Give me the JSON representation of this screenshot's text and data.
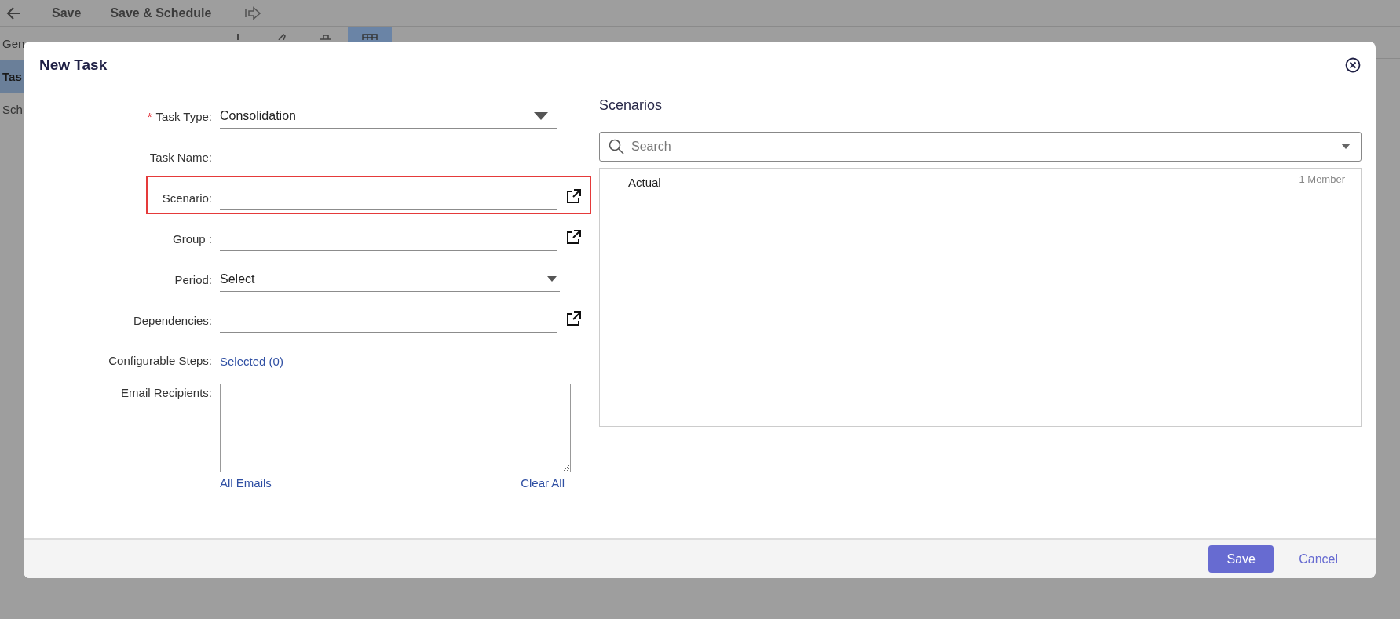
{
  "toolbar": {
    "buttons": [
      {
        "label": "Save"
      },
      {
        "label": "Save & Schedule"
      }
    ]
  },
  "sidebar": {
    "items": [
      {
        "label": "Gen",
        "selected": false
      },
      {
        "label": "Tas",
        "selected": true
      },
      {
        "label": "Sch",
        "selected": false
      }
    ]
  },
  "content_toolbar": {
    "tools": [
      {
        "kind": "add",
        "selected": false
      },
      {
        "kind": "edit",
        "selected": false
      },
      {
        "kind": "delete",
        "selected": false
      },
      {
        "kind": "grid",
        "selected": true
      }
    ]
  },
  "dialog": {
    "title": "New Task",
    "fields": [
      {
        "kind": "select",
        "label": "Task Type:",
        "required_mark": "*",
        "value": "Consolidation",
        "highlighted": false
      },
      {
        "kind": "text",
        "label": "Task Name:",
        "highlighted": false
      },
      {
        "kind": "picker",
        "label": "Scenario:",
        "highlighted": true
      },
      {
        "kind": "picker",
        "label": "Group :",
        "highlighted": false
      },
      {
        "kind": "select",
        "label": "Period:",
        "value": "Select",
        "highlighted": false
      },
      {
        "kind": "picker",
        "label": "Dependencies:",
        "highlighted": false
      },
      {
        "kind": "link",
        "label": "Configurable Steps:",
        "value": "Selected (0)",
        "highlighted": false
      },
      {
        "kind": "textarea",
        "label": "Email Recipients:",
        "links": [
          "All Emails",
          "Clear All"
        ],
        "highlighted": false
      }
    ],
    "scenarios": {
      "title": "Scenarios",
      "search": {
        "placeholder": "Search"
      },
      "items": [
        {
          "name": "Actual",
          "count": "1 Member"
        }
      ]
    },
    "footer_buttons": [
      {
        "kind": "primary",
        "label": "Save"
      },
      {
        "kind": "link",
        "label": "Cancel"
      }
    ]
  }
}
